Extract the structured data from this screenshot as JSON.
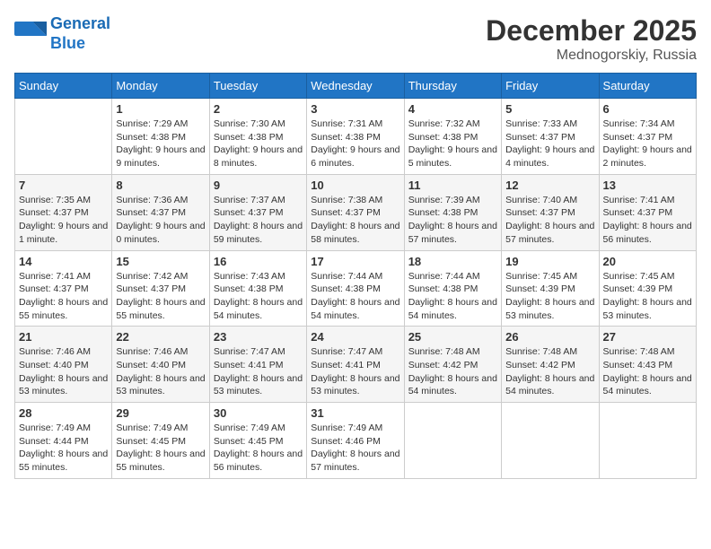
{
  "logo": {
    "line1": "General",
    "line2": "Blue"
  },
  "title": "December 2025",
  "location": "Mednogorskiy, Russia",
  "weekdays": [
    "Sunday",
    "Monday",
    "Tuesday",
    "Wednesday",
    "Thursday",
    "Friday",
    "Saturday"
  ],
  "weeks": [
    [
      {
        "day": "",
        "sunrise": "",
        "sunset": "",
        "daylight": ""
      },
      {
        "day": "1",
        "sunrise": "Sunrise: 7:29 AM",
        "sunset": "Sunset: 4:38 PM",
        "daylight": "Daylight: 9 hours and 9 minutes."
      },
      {
        "day": "2",
        "sunrise": "Sunrise: 7:30 AM",
        "sunset": "Sunset: 4:38 PM",
        "daylight": "Daylight: 9 hours and 8 minutes."
      },
      {
        "day": "3",
        "sunrise": "Sunrise: 7:31 AM",
        "sunset": "Sunset: 4:38 PM",
        "daylight": "Daylight: 9 hours and 6 minutes."
      },
      {
        "day": "4",
        "sunrise": "Sunrise: 7:32 AM",
        "sunset": "Sunset: 4:38 PM",
        "daylight": "Daylight: 9 hours and 5 minutes."
      },
      {
        "day": "5",
        "sunrise": "Sunrise: 7:33 AM",
        "sunset": "Sunset: 4:37 PM",
        "daylight": "Daylight: 9 hours and 4 minutes."
      },
      {
        "day": "6",
        "sunrise": "Sunrise: 7:34 AM",
        "sunset": "Sunset: 4:37 PM",
        "daylight": "Daylight: 9 hours and 2 minutes."
      }
    ],
    [
      {
        "day": "7",
        "sunrise": "Sunrise: 7:35 AM",
        "sunset": "Sunset: 4:37 PM",
        "daylight": "Daylight: 9 hours and 1 minute."
      },
      {
        "day": "8",
        "sunrise": "Sunrise: 7:36 AM",
        "sunset": "Sunset: 4:37 PM",
        "daylight": "Daylight: 9 hours and 0 minutes."
      },
      {
        "day": "9",
        "sunrise": "Sunrise: 7:37 AM",
        "sunset": "Sunset: 4:37 PM",
        "daylight": "Daylight: 8 hours and 59 minutes."
      },
      {
        "day": "10",
        "sunrise": "Sunrise: 7:38 AM",
        "sunset": "Sunset: 4:37 PM",
        "daylight": "Daylight: 8 hours and 58 minutes."
      },
      {
        "day": "11",
        "sunrise": "Sunrise: 7:39 AM",
        "sunset": "Sunset: 4:38 PM",
        "daylight": "Daylight: 8 hours and 57 minutes."
      },
      {
        "day": "12",
        "sunrise": "Sunrise: 7:40 AM",
        "sunset": "Sunset: 4:37 PM",
        "daylight": "Daylight: 8 hours and 57 minutes."
      },
      {
        "day": "13",
        "sunrise": "Sunrise: 7:41 AM",
        "sunset": "Sunset: 4:37 PM",
        "daylight": "Daylight: 8 hours and 56 minutes."
      }
    ],
    [
      {
        "day": "14",
        "sunrise": "Sunrise: 7:41 AM",
        "sunset": "Sunset: 4:37 PM",
        "daylight": "Daylight: 8 hours and 55 minutes."
      },
      {
        "day": "15",
        "sunrise": "Sunrise: 7:42 AM",
        "sunset": "Sunset: 4:37 PM",
        "daylight": "Daylight: 8 hours and 55 minutes."
      },
      {
        "day": "16",
        "sunrise": "Sunrise: 7:43 AM",
        "sunset": "Sunset: 4:38 PM",
        "daylight": "Daylight: 8 hours and 54 minutes."
      },
      {
        "day": "17",
        "sunrise": "Sunrise: 7:44 AM",
        "sunset": "Sunset: 4:38 PM",
        "daylight": "Daylight: 8 hours and 54 minutes."
      },
      {
        "day": "18",
        "sunrise": "Sunrise: 7:44 AM",
        "sunset": "Sunset: 4:38 PM",
        "daylight": "Daylight: 8 hours and 54 minutes."
      },
      {
        "day": "19",
        "sunrise": "Sunrise: 7:45 AM",
        "sunset": "Sunset: 4:39 PM",
        "daylight": "Daylight: 8 hours and 53 minutes."
      },
      {
        "day": "20",
        "sunrise": "Sunrise: 7:45 AM",
        "sunset": "Sunset: 4:39 PM",
        "daylight": "Daylight: 8 hours and 53 minutes."
      }
    ],
    [
      {
        "day": "21",
        "sunrise": "Sunrise: 7:46 AM",
        "sunset": "Sunset: 4:40 PM",
        "daylight": "Daylight: 8 hours and 53 minutes."
      },
      {
        "day": "22",
        "sunrise": "Sunrise: 7:46 AM",
        "sunset": "Sunset: 4:40 PM",
        "daylight": "Daylight: 8 hours and 53 minutes."
      },
      {
        "day": "23",
        "sunrise": "Sunrise: 7:47 AM",
        "sunset": "Sunset: 4:41 PM",
        "daylight": "Daylight: 8 hours and 53 minutes."
      },
      {
        "day": "24",
        "sunrise": "Sunrise: 7:47 AM",
        "sunset": "Sunset: 4:41 PM",
        "daylight": "Daylight: 8 hours and 53 minutes."
      },
      {
        "day": "25",
        "sunrise": "Sunrise: 7:48 AM",
        "sunset": "Sunset: 4:42 PM",
        "daylight": "Daylight: 8 hours and 54 minutes."
      },
      {
        "day": "26",
        "sunrise": "Sunrise: 7:48 AM",
        "sunset": "Sunset: 4:42 PM",
        "daylight": "Daylight: 8 hours and 54 minutes."
      },
      {
        "day": "27",
        "sunrise": "Sunrise: 7:48 AM",
        "sunset": "Sunset: 4:43 PM",
        "daylight": "Daylight: 8 hours and 54 minutes."
      }
    ],
    [
      {
        "day": "28",
        "sunrise": "Sunrise: 7:49 AM",
        "sunset": "Sunset: 4:44 PM",
        "daylight": "Daylight: 8 hours and 55 minutes."
      },
      {
        "day": "29",
        "sunrise": "Sunrise: 7:49 AM",
        "sunset": "Sunset: 4:45 PM",
        "daylight": "Daylight: 8 hours and 55 minutes."
      },
      {
        "day": "30",
        "sunrise": "Sunrise: 7:49 AM",
        "sunset": "Sunset: 4:45 PM",
        "daylight": "Daylight: 8 hours and 56 minutes."
      },
      {
        "day": "31",
        "sunrise": "Sunrise: 7:49 AM",
        "sunset": "Sunset: 4:46 PM",
        "daylight": "Daylight: 8 hours and 57 minutes."
      },
      {
        "day": "",
        "sunrise": "",
        "sunset": "",
        "daylight": ""
      },
      {
        "day": "",
        "sunrise": "",
        "sunset": "",
        "daylight": ""
      },
      {
        "day": "",
        "sunrise": "",
        "sunset": "",
        "daylight": ""
      }
    ]
  ]
}
